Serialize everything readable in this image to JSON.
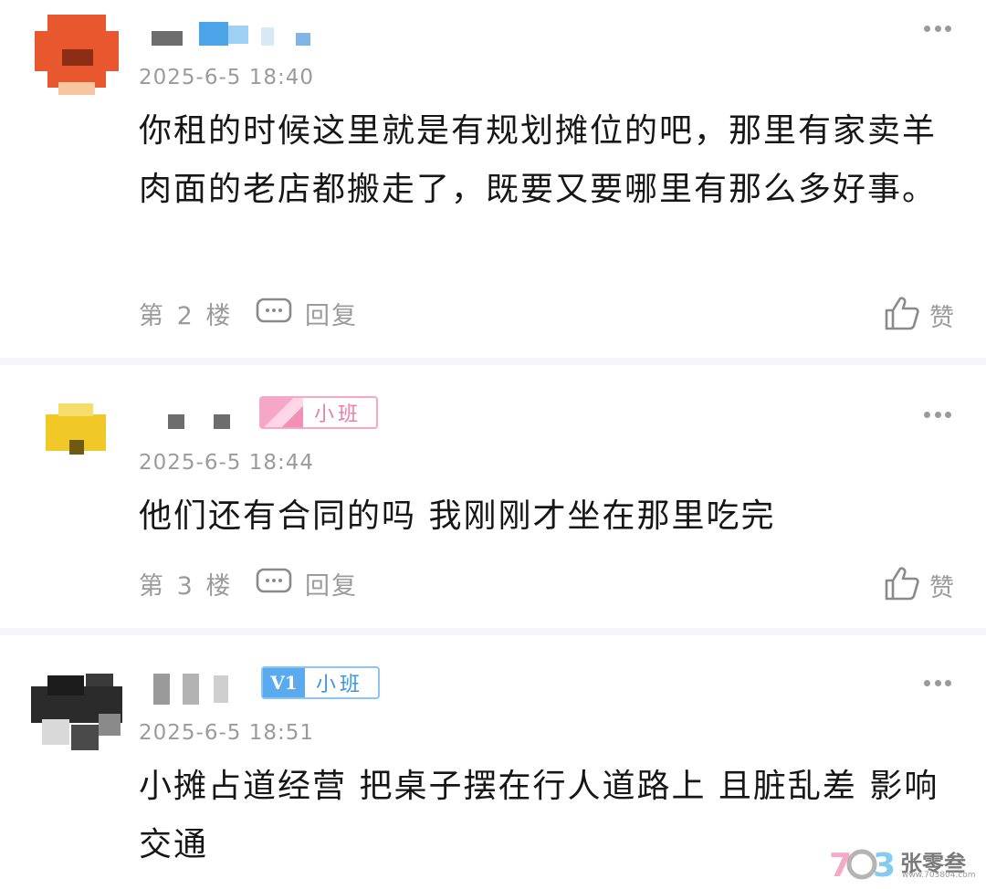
{
  "comments": [
    {
      "timestamp": "2025-6-5 18:40",
      "text": "你租的时候这里就是有规划摊位的吧，那里有家卖羊肉面的老店都搬走了，既要又要哪里有那么多好事。",
      "floor": "第 2 楼",
      "reply_label": "回复",
      "like_label": "赞"
    },
    {
      "timestamp": "2025-6-5 18:44",
      "text": "他们还有合同的吗 我刚刚才坐在那里吃完",
      "floor": "第 3 楼",
      "reply_label": "回复",
      "like_label": "赞",
      "badge": {
        "text": "小班",
        "color": "#ea7fa7"
      }
    },
    {
      "timestamp": "2025-6-5 18:51",
      "text": "小摊占道经营 把桌子摆在行人道路上 且脏乱差 影响交通",
      "badge": {
        "level": "V1",
        "text": "小班",
        "color": "#3d94e0"
      }
    }
  ],
  "icons": {
    "more": "more-horizontal-icon",
    "reply": "comment-bubble-icon",
    "like": "thumbs-up-icon"
  },
  "watermark": {
    "logo": "703",
    "name": "张零叁",
    "url": "www.703804.com"
  }
}
